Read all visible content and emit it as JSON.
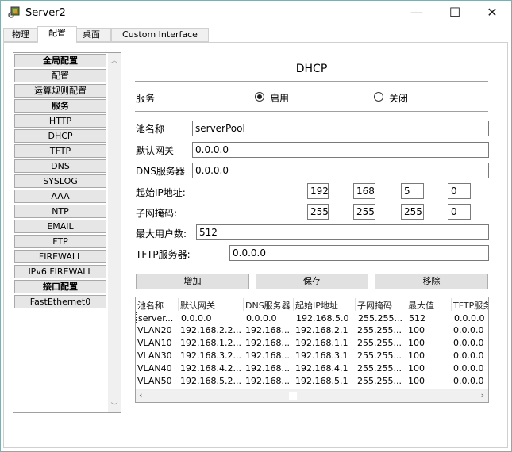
{
  "window": {
    "title": "Server2",
    "minimize": "—",
    "maximize": "☐",
    "close": "✕",
    "icon": "server-icon"
  },
  "tabs": [
    {
      "label": "物理"
    },
    {
      "label": "配置",
      "active": true
    },
    {
      "label": "桌面"
    },
    {
      "label": "Custom Interface"
    }
  ],
  "sidebar": {
    "items": [
      {
        "label": "全局配置",
        "bold": true
      },
      {
        "label": "配置"
      },
      {
        "label": "运算规则配置"
      },
      {
        "label": "服务",
        "bold": true
      },
      {
        "label": "HTTP"
      },
      {
        "label": "DHCP"
      },
      {
        "label": "TFTP"
      },
      {
        "label": "DNS"
      },
      {
        "label": "SYSLOG"
      },
      {
        "label": "AAA"
      },
      {
        "label": "NTP"
      },
      {
        "label": "EMAIL"
      },
      {
        "label": "FTP"
      },
      {
        "label": "FIREWALL"
      },
      {
        "label": "IPv6 FIREWALL"
      },
      {
        "label": "接口配置",
        "bold": true
      },
      {
        "label": "FastEthernet0"
      }
    ]
  },
  "dhcp": {
    "heading": "DHCP",
    "service_label": "服务",
    "on_label": "启用",
    "off_label": "关闭",
    "service_on": true,
    "pool_name_label": "池名称",
    "pool_name": "serverPool",
    "gateway_label": "默认网关",
    "gateway": "0.0.0.0",
    "dns_label": "DNS服务器",
    "dns": "0.0.0.0",
    "start_ip_label": "起始IP地址:",
    "start_ip": [
      "192",
      "168",
      "5",
      "0"
    ],
    "mask_label": "子网掩码:",
    "mask": [
      "255",
      "255",
      "255",
      "0"
    ],
    "max_users_label": "最大用户数:",
    "max_users": "512",
    "tftp_label": "TFTP服务器:",
    "tftp": "0.0.0.0",
    "add": "增加",
    "save": "保存",
    "remove": "移除"
  },
  "table": {
    "headers": [
      "池名称",
      "默认网关",
      "DNS服务器",
      "起始IP地址",
      "子网掩码",
      "最大值",
      "TFTP服务器"
    ],
    "rows": [
      [
        "server...",
        "0.0.0.0",
        "0.0.0.0",
        "192.168.5.0",
        "255.255...",
        "512",
        "0.0.0.0"
      ],
      [
        "VLAN20",
        "192.168.2.2...",
        "192.168...",
        "192.168.2.1",
        "255.255...",
        "100",
        "0.0.0.0"
      ],
      [
        "VLAN10",
        "192.168.1.2...",
        "192.168...",
        "192.168.1.1",
        "255.255...",
        "100",
        "0.0.0.0"
      ],
      [
        "VLAN30",
        "192.168.3.2...",
        "192.168...",
        "192.168.3.1",
        "255.255...",
        "100",
        "0.0.0.0"
      ],
      [
        "VLAN40",
        "192.168.4.2...",
        "192.168...",
        "192.168.4.1",
        "255.255...",
        "100",
        "0.0.0.0"
      ],
      [
        "VLAN50",
        "192.168.5.2...",
        "192.168...",
        "192.168.5.1",
        "255.255...",
        "100",
        "0.0.0.0"
      ]
    ]
  }
}
